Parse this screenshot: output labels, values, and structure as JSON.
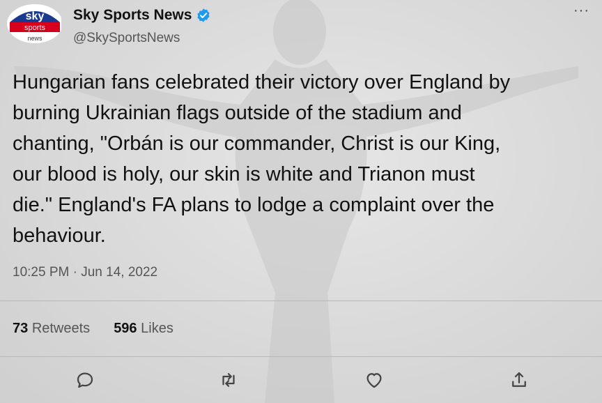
{
  "account": {
    "display_name": "Sky Sports News",
    "handle": "@SkySportsNews",
    "avatar_logo": {
      "line1": "sky",
      "line2": "sports",
      "line3": "news"
    },
    "verified_icon": "verified-badge-icon",
    "verified_color": "#1d9bf0"
  },
  "more_label": "···",
  "tweet": {
    "lines": [
      "Hungarian fans celebrated their victory over England by",
      "burning Ukrainian flags outside of the stadium and",
      "chanting, \"Orbán is our commander, Christ is our King,",
      "our blood is holy, our skin is white and Trianon must",
      "die.\" England's FA plans to lodge a complaint over the",
      "behaviour."
    ],
    "timestamp": "10:25 PM · Jun 14, 2022"
  },
  "stats": {
    "retweets_count": "73",
    "retweets_label": "Retweets",
    "likes_count": "596",
    "likes_label": "Likes"
  },
  "actions": [
    "reply-icon",
    "retweet-icon",
    "like-icon",
    "share-icon"
  ],
  "colors": {
    "text": "#111111",
    "secondary": "#555555",
    "logo_red": "#d6001c",
    "logo_blue": "#1a3a8f"
  }
}
